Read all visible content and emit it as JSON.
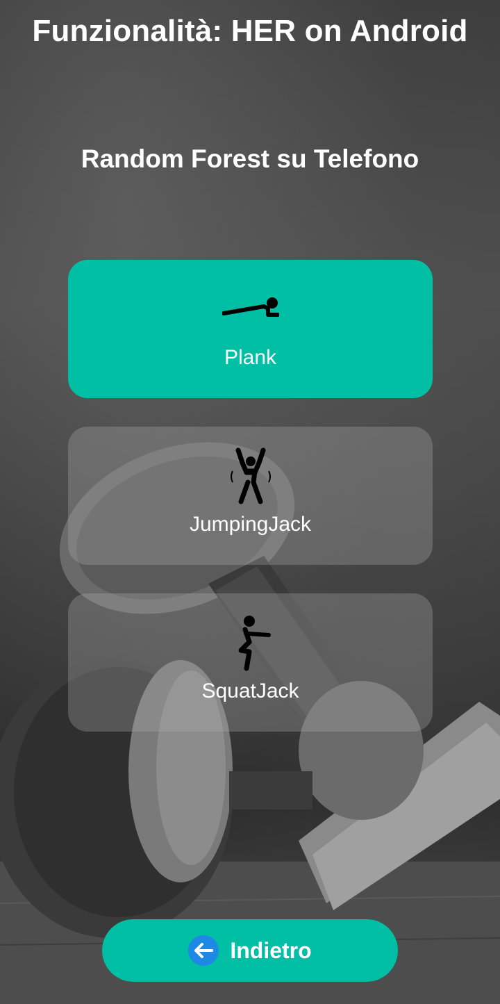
{
  "header": {
    "title": "Funzionalità: HER on Android",
    "subtitle": "Random Forest su Telefono"
  },
  "exercises": [
    {
      "label": "Plank",
      "icon": "plank-icon",
      "selected": true
    },
    {
      "label": "JumpingJack",
      "icon": "jumping-jack-icon",
      "selected": false
    },
    {
      "label": "SquatJack",
      "icon": "squat-jack-icon",
      "selected": false
    }
  ],
  "back_button": {
    "label": "Indietro",
    "icon": "arrow-left-icon"
  },
  "colors": {
    "accent": "#00bfa5",
    "back_icon_circle": "#1e88e5",
    "card_inactive": "rgba(170,170,170,0.32)",
    "text": "#ffffff"
  },
  "background": {
    "image": "dumbbell-photo-grayscale"
  }
}
